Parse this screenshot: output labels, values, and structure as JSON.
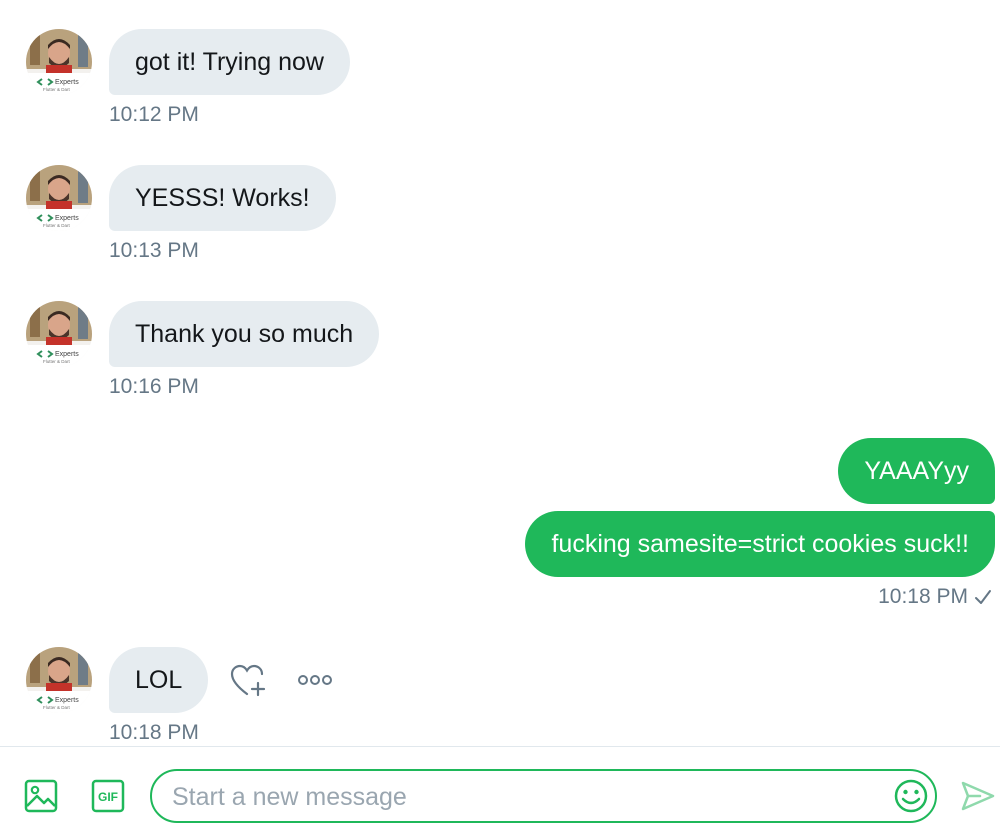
{
  "conversation": {
    "messages": [
      {
        "direction": "in",
        "text": "got it! Trying now",
        "time": "10:12 PM"
      },
      {
        "direction": "in",
        "text": "YESSS! Works!",
        "time": "10:13 PM"
      },
      {
        "direction": "in",
        "text": "Thank you so much",
        "time": "10:16 PM"
      },
      {
        "direction": "out",
        "texts": [
          "YAAAYyy",
          "fucking samesite=strict cookies suck!!"
        ],
        "time": "10:18 PM",
        "status_icon": "check-icon"
      },
      {
        "direction": "in",
        "text": "LOL",
        "time": "10:18 PM",
        "actions": [
          "heart-plus-icon",
          "more-icon"
        ]
      }
    ],
    "avatar": {
      "caption": "Experts",
      "subcaption": "Flutter & Dart"
    }
  },
  "composer": {
    "placeholder": "Start a new message",
    "value": "",
    "icons": [
      "image-icon",
      "gif-icon",
      "emoji-icon",
      "send-icon"
    ],
    "gif_label": "GIF"
  },
  "colors": {
    "accent": "#1fb85a",
    "incoming_bubble": "#e6ecf0",
    "timestamp": "#657786",
    "text": "#14171a"
  }
}
